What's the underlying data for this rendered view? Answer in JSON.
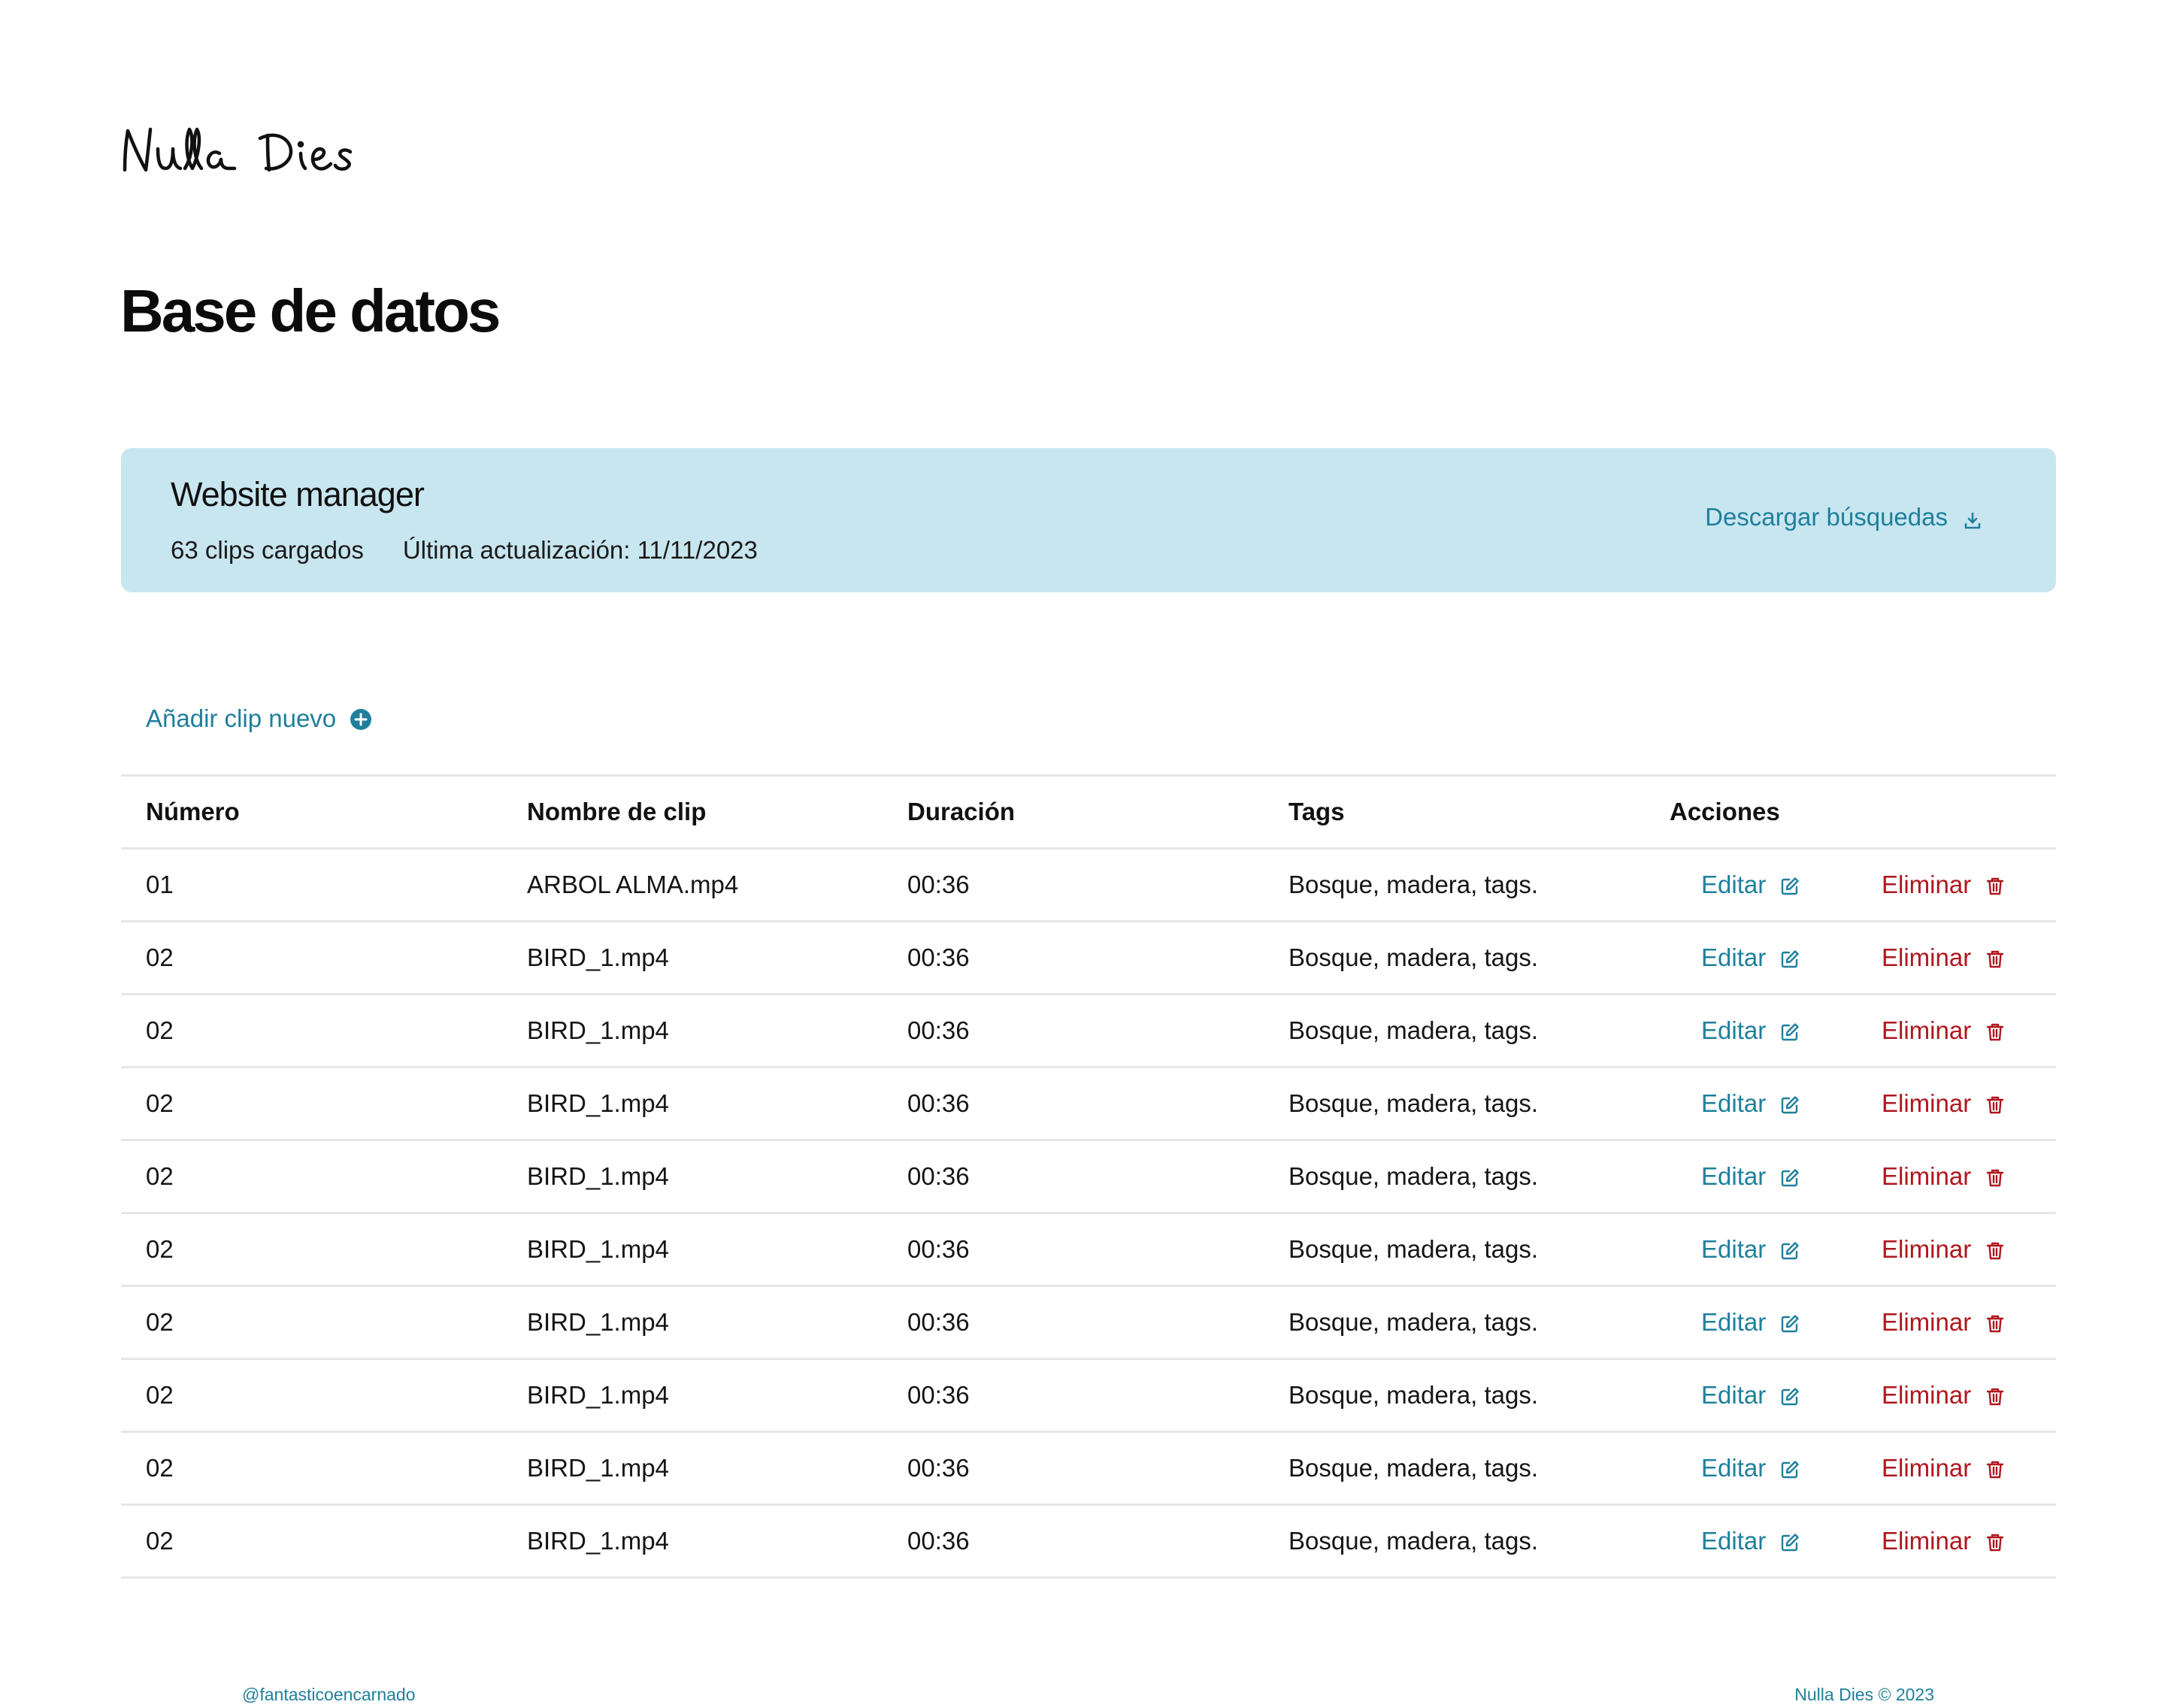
{
  "brand": {
    "logo_text": "Nulla Dies"
  },
  "page": {
    "title": "Base de datos"
  },
  "panel": {
    "title": "Website manager",
    "clips_loaded": "63 clips cargados",
    "last_update": "Última actualización: 11/11/2023",
    "download_label": "Descargar búsquedas",
    "background_color": "#c8e6ef"
  },
  "actions": {
    "add_clip_label": "Añadir clip nuevo"
  },
  "table": {
    "headers": {
      "number": "Número",
      "name": "Nombre de clip",
      "duration": "Duración",
      "tags": "Tags",
      "actions": "Acciones"
    },
    "edit_label": "Editar",
    "delete_label": "Eliminar",
    "rows": [
      {
        "number": "01",
        "name": "ARBOL ALMA.mp4",
        "duration": "00:36",
        "tags": "Bosque, madera, tags."
      },
      {
        "number": "02",
        "name": "BIRD_1.mp4",
        "duration": "00:36",
        "tags": "Bosque, madera, tags."
      },
      {
        "number": "02",
        "name": "BIRD_1.mp4",
        "duration": "00:36",
        "tags": "Bosque, madera, tags."
      },
      {
        "number": "02",
        "name": "BIRD_1.mp4",
        "duration": "00:36",
        "tags": "Bosque, madera, tags."
      },
      {
        "number": "02",
        "name": "BIRD_1.mp4",
        "duration": "00:36",
        "tags": "Bosque, madera, tags."
      },
      {
        "number": "02",
        "name": "BIRD_1.mp4",
        "duration": "00:36",
        "tags": "Bosque, madera, tags."
      },
      {
        "number": "02",
        "name": "BIRD_1.mp4",
        "duration": "00:36",
        "tags": "Bosque, madera, tags."
      },
      {
        "number": "02",
        "name": "BIRD_1.mp4",
        "duration": "00:36",
        "tags": "Bosque, madera, tags."
      },
      {
        "number": "02",
        "name": "BIRD_1.mp4",
        "duration": "00:36",
        "tags": "Bosque, madera, tags."
      },
      {
        "number": "02",
        "name": "BIRD_1.mp4",
        "duration": "00:36",
        "tags": "Bosque, madera, tags."
      }
    ]
  },
  "footer": {
    "handle": "@fantasticoencarnado",
    "copyright": "Nulla Dies © 2023"
  },
  "colors": {
    "accent": "#1f7f9c",
    "danger": "#b0161d",
    "divider": "#e6e6e6"
  },
  "icons": {
    "download": "download-icon",
    "add": "plus-circle-icon",
    "edit": "edit-icon",
    "delete": "trash-icon"
  }
}
